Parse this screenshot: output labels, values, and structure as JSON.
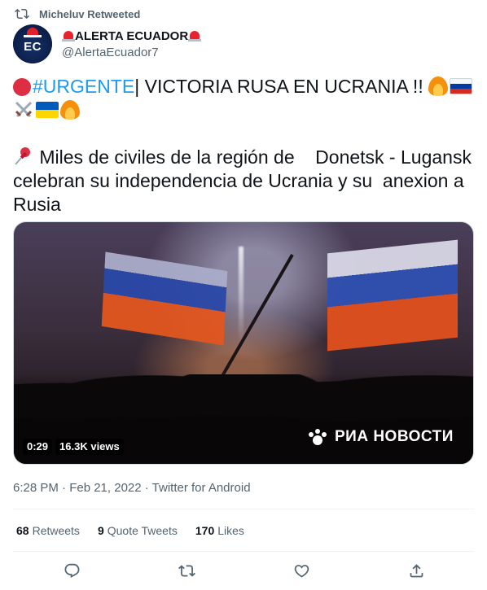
{
  "retweet_context": {
    "label": "Micheluv Retweeted",
    "icon": "retweet-icon"
  },
  "author": {
    "display_name": "ALERTA ECUADOR",
    "handle": "@AlertaEcuador7",
    "avatar_text": "EC",
    "name_emoji": "police-siren"
  },
  "tweet": {
    "line1_hashtag": "#URGENTE",
    "line1_text": "| VICTORIA RUSA EN UCRANIA !! ",
    "line3_text": " Miles de civiles de la región de    Donetsk - Lugansk",
    "line4_text": "celebran su independencia de Ucrania y su  anexion a",
    "line5_text": "Rusia"
  },
  "media": {
    "duration": "0:29",
    "views": "16.3K views",
    "watermark_text": "РИА НОВОСТИ"
  },
  "meta": {
    "text": "6:28 PM · Feb 21, 2022 · Twitter for Android"
  },
  "stats": {
    "retweets_count": "68",
    "retweets_label": "Retweets",
    "quotes_count": "9",
    "quotes_label": "Quote Tweets",
    "likes_count": "170",
    "likes_label": "Likes"
  },
  "actions": [
    "reply-icon",
    "retweet-icon",
    "like-icon",
    "share-icon"
  ],
  "colors": {
    "hashtag": "#1d9bf0",
    "secondary_text": "#536471",
    "primary_text": "#0f1419"
  }
}
